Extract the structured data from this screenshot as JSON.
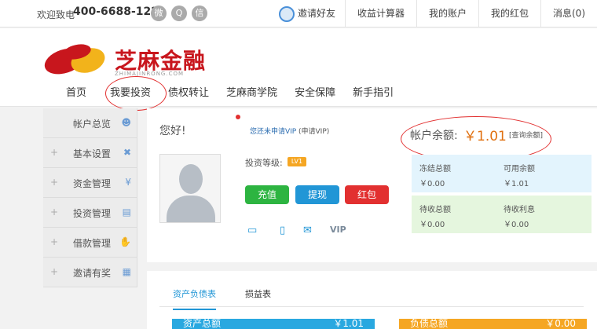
{
  "topbar": {
    "welcome": "欢迎致电",
    "phone": "400-6688-122",
    "social_icons": [
      "weibo-icon",
      "qq-icon",
      "wechat-icon"
    ],
    "links": {
      "invite": "邀请好友",
      "calculator": "收益计算器",
      "account": "我的账户",
      "redpacket": "我的红包",
      "messages": "消息(0)"
    }
  },
  "header": {
    "logo_text": "芝麻金融",
    "logo_sub": "ZHIMAJINRONG.COM",
    "nav": [
      "首页",
      "我要投资",
      "债权转让",
      "芝麻商学院",
      "安全保障",
      "新手指引"
    ]
  },
  "sidebar": {
    "items": [
      {
        "label": "帐户总览",
        "plus": "",
        "icon": "user-icon"
      },
      {
        "label": "基本设置",
        "plus": "+",
        "icon": "tools-icon"
      },
      {
        "label": "资金管理",
        "plus": "+",
        "icon": "yen-icon"
      },
      {
        "label": "投资管理",
        "plus": "+",
        "icon": "chart-icon"
      },
      {
        "label": "借款管理",
        "plus": "+",
        "icon": "hand-icon"
      },
      {
        "label": "邀请有奖",
        "plus": "+",
        "icon": "gift-icon"
      }
    ]
  },
  "profile": {
    "hello": "您好!",
    "vip_link": "您还未申请VIP",
    "vip_apply": "(申请VIP)",
    "level_label": "投资等级:",
    "level_badge": "LV1",
    "buttons": {
      "recharge": "充值",
      "withdraw": "提现",
      "redpacket": "红包"
    },
    "verify_icons": [
      "bank-card-icon",
      "phone-icon",
      "mail-icon",
      "vip-icon"
    ],
    "verify_vip": "VIP"
  },
  "account": {
    "balance_label": "帐户余额:",
    "balance_value": "￥1.01",
    "balance_query": "[查询余额]",
    "stats": [
      {
        "label": "冻结总额",
        "value": "￥0.00"
      },
      {
        "label": "可用余额",
        "value": "￥1.01"
      },
      {
        "label": "待收总额",
        "value": "￥0.00"
      },
      {
        "label": "待收利息",
        "value": "￥0.00"
      }
    ]
  },
  "lower": {
    "tabs": [
      "资产负债表",
      "损益表"
    ],
    "assets_label": "资产总额",
    "assets_value": "￥1.01",
    "liability_label": "负债总额",
    "liability_value": "￥0.00"
  }
}
